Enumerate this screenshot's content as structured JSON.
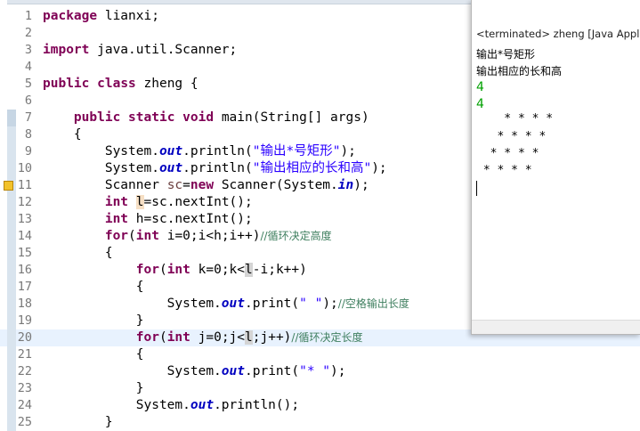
{
  "editor": {
    "lines": [
      {
        "num": "1",
        "tokens": [
          {
            "t": "package",
            "c": "kw"
          },
          {
            "t": " lianxi;"
          }
        ]
      },
      {
        "num": "2",
        "tokens": []
      },
      {
        "num": "3",
        "tokens": [
          {
            "t": "import",
            "c": "kw"
          },
          {
            "t": " java.util.Scanner;"
          }
        ]
      },
      {
        "num": "4",
        "tokens": []
      },
      {
        "num": "5",
        "tokens": [
          {
            "t": "public",
            "c": "kw"
          },
          {
            "t": " "
          },
          {
            "t": "class",
            "c": "kw"
          },
          {
            "t": " zheng {"
          }
        ]
      },
      {
        "num": "6",
        "tokens": []
      },
      {
        "num": "7",
        "fold": true,
        "tokens": [
          {
            "t": "    "
          },
          {
            "t": "public",
            "c": "kw"
          },
          {
            "t": " "
          },
          {
            "t": "static",
            "c": "kw"
          },
          {
            "t": " "
          },
          {
            "t": "void",
            "c": "kw"
          },
          {
            "t": " main(String[] args)"
          }
        ]
      },
      {
        "num": "8",
        "tokens": [
          {
            "t": "    {"
          }
        ]
      },
      {
        "num": "9",
        "tokens": [
          {
            "t": "        System."
          },
          {
            "t": "out",
            "c": "fld"
          },
          {
            "t": ".println("
          },
          {
            "t": "\"输出*号矩形\"",
            "c": "str"
          },
          {
            "t": ");"
          }
        ]
      },
      {
        "num": "10",
        "tokens": [
          {
            "t": "        System."
          },
          {
            "t": "out",
            "c": "fld"
          },
          {
            "t": ".println("
          },
          {
            "t": "\"输出相应的长和高\"",
            "c": "str"
          },
          {
            "t": ");"
          }
        ]
      },
      {
        "num": "11",
        "warn": true,
        "tokens": [
          {
            "t": "        Scanner "
          },
          {
            "t": "sc",
            "c": "var"
          },
          {
            "t": "="
          },
          {
            "t": "new",
            "c": "kw"
          },
          {
            "t": " Scanner(System."
          },
          {
            "t": "in",
            "c": "fld"
          },
          {
            "t": ");"
          }
        ]
      },
      {
        "num": "12",
        "tokens": [
          {
            "t": "        "
          },
          {
            "t": "int",
            "c": "kw"
          },
          {
            "t": " "
          },
          {
            "t": "l",
            "c": "hlo"
          },
          {
            "t": "=sc.nextInt();"
          }
        ]
      },
      {
        "num": "13",
        "tokens": [
          {
            "t": "        "
          },
          {
            "t": "int",
            "c": "kw"
          },
          {
            "t": " h=sc.nextInt();"
          }
        ]
      },
      {
        "num": "14",
        "tokens": [
          {
            "t": "        "
          },
          {
            "t": "for",
            "c": "kw"
          },
          {
            "t": "("
          },
          {
            "t": "int",
            "c": "kw"
          },
          {
            "t": " i=0;i<h;i++)"
          },
          {
            "t": "//循环决定高度",
            "c": "cmt"
          }
        ]
      },
      {
        "num": "15",
        "tokens": [
          {
            "t": "        {"
          }
        ]
      },
      {
        "num": "16",
        "tokens": [
          {
            "t": "            "
          },
          {
            "t": "for",
            "c": "kw"
          },
          {
            "t": "("
          },
          {
            "t": "int",
            "c": "kw"
          },
          {
            "t": " k=0;k<"
          },
          {
            "t": "l",
            "c": "hl"
          },
          {
            "t": "-i;k++)"
          }
        ]
      },
      {
        "num": "17",
        "tokens": [
          {
            "t": "            {"
          }
        ]
      },
      {
        "num": "18",
        "tokens": [
          {
            "t": "                System."
          },
          {
            "t": "out",
            "c": "fld"
          },
          {
            "t": ".print("
          },
          {
            "t": "\" \"",
            "c": "str"
          },
          {
            "t": ");"
          },
          {
            "t": "//空格输出长度",
            "c": "cmt"
          }
        ]
      },
      {
        "num": "19",
        "tokens": [
          {
            "t": "            }"
          }
        ]
      },
      {
        "num": "20",
        "current": true,
        "tokens": [
          {
            "t": "            "
          },
          {
            "t": "for",
            "c": "kw"
          },
          {
            "t": "("
          },
          {
            "t": "int",
            "c": "kw"
          },
          {
            "t": " j=0;j<"
          },
          {
            "t": "l",
            "c": "hl"
          },
          {
            "t": ";j++)"
          },
          {
            "t": "//循环决定长度",
            "c": "cmt"
          }
        ]
      },
      {
        "num": "21",
        "tokens": [
          {
            "t": "            {"
          }
        ]
      },
      {
        "num": "22",
        "tokens": [
          {
            "t": "                System."
          },
          {
            "t": "out",
            "c": "fld"
          },
          {
            "t": ".print("
          },
          {
            "t": "\"* \"",
            "c": "str"
          },
          {
            "t": ");"
          }
        ]
      },
      {
        "num": "23",
        "tokens": [
          {
            "t": "            }"
          }
        ]
      },
      {
        "num": "24",
        "tokens": [
          {
            "t": "            System."
          },
          {
            "t": "out",
            "c": "fld"
          },
          {
            "t": ".println();"
          }
        ]
      },
      {
        "num": "25",
        "tokens": [
          {
            "t": "        }"
          }
        ]
      }
    ]
  },
  "console": {
    "title": "<terminated> zheng [Java Appli",
    "output": [
      {
        "text": "输出*号矩形",
        "kind": "out"
      },
      {
        "text": "输出相应的长和高",
        "kind": "out"
      },
      {
        "text": "4",
        "kind": "inp"
      },
      {
        "text": "4",
        "kind": "inp"
      },
      {
        "text": "    * * * * ",
        "kind": "stars"
      },
      {
        "text": "   * * * * ",
        "kind": "stars"
      },
      {
        "text": "  * * * * ",
        "kind": "stars"
      },
      {
        "text": " * * * * ",
        "kind": "stars"
      }
    ]
  },
  "colors": {
    "keyword": "#7f0055",
    "string": "#2a00ff",
    "comment": "#3f7f5f",
    "field": "#0000c0",
    "input": "#00a000",
    "current_line": "#e8f2fe"
  }
}
